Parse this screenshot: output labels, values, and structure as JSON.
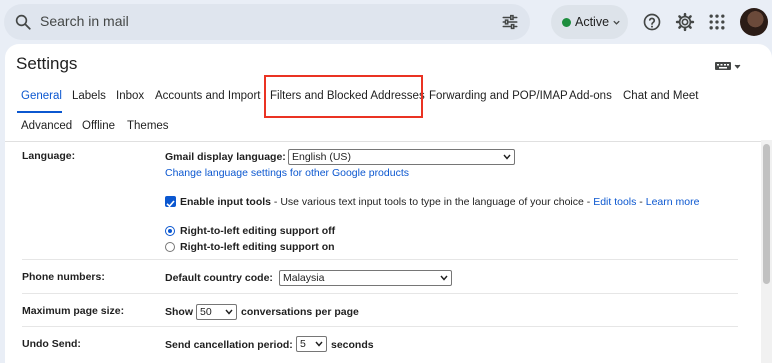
{
  "search": {
    "placeholder": "Search in mail"
  },
  "status": {
    "label": "Active",
    "color": "#1e8e3e"
  },
  "header_icons": [
    "help-icon",
    "settings-gear-icon",
    "apps-grid-icon",
    "account-avatar"
  ],
  "settings": {
    "title": "Settings",
    "tabs_row1": [
      "General",
      "Labels",
      "Inbox",
      "Accounts and Import",
      "Filters and Blocked Addresses",
      "Forwarding and POP/IMAP",
      "Add-ons",
      "Chat and Meet"
    ],
    "tabs_row2": [
      "Advanced",
      "Offline",
      "Themes"
    ],
    "selected_tab": "General",
    "highlighted_tab": "Filters and Blocked Addresses",
    "highlight_color": "#ea3323",
    "accent_color": "#0b57d0"
  },
  "language": {
    "label": "Language:",
    "display_label": "Gmail display language:",
    "display_value": "English (US)",
    "change_link": "Change language settings for other Google products",
    "input_tools_checked": true,
    "input_tools_label": "Enable input tools",
    "input_tools_desc": " - Use various text input tools to type in the language of your choice - ",
    "edit_tools": "Edit tools",
    "dash": " - ",
    "learn_more": "Learn more",
    "rtl_off": "Right-to-left editing support off",
    "rtl_on": "Right-to-left editing support on",
    "rtl_selected": "off"
  },
  "phone": {
    "label": "Phone numbers:",
    "country_label": "Default country code:",
    "country_value": "Malaysia"
  },
  "page_size": {
    "label": "Maximum page size:",
    "show": "Show",
    "value": "50",
    "suffix": "conversations per page"
  },
  "undo_send": {
    "label": "Undo Send:",
    "period_label": "Send cancellation period:",
    "value": "5",
    "suffix": "seconds"
  }
}
